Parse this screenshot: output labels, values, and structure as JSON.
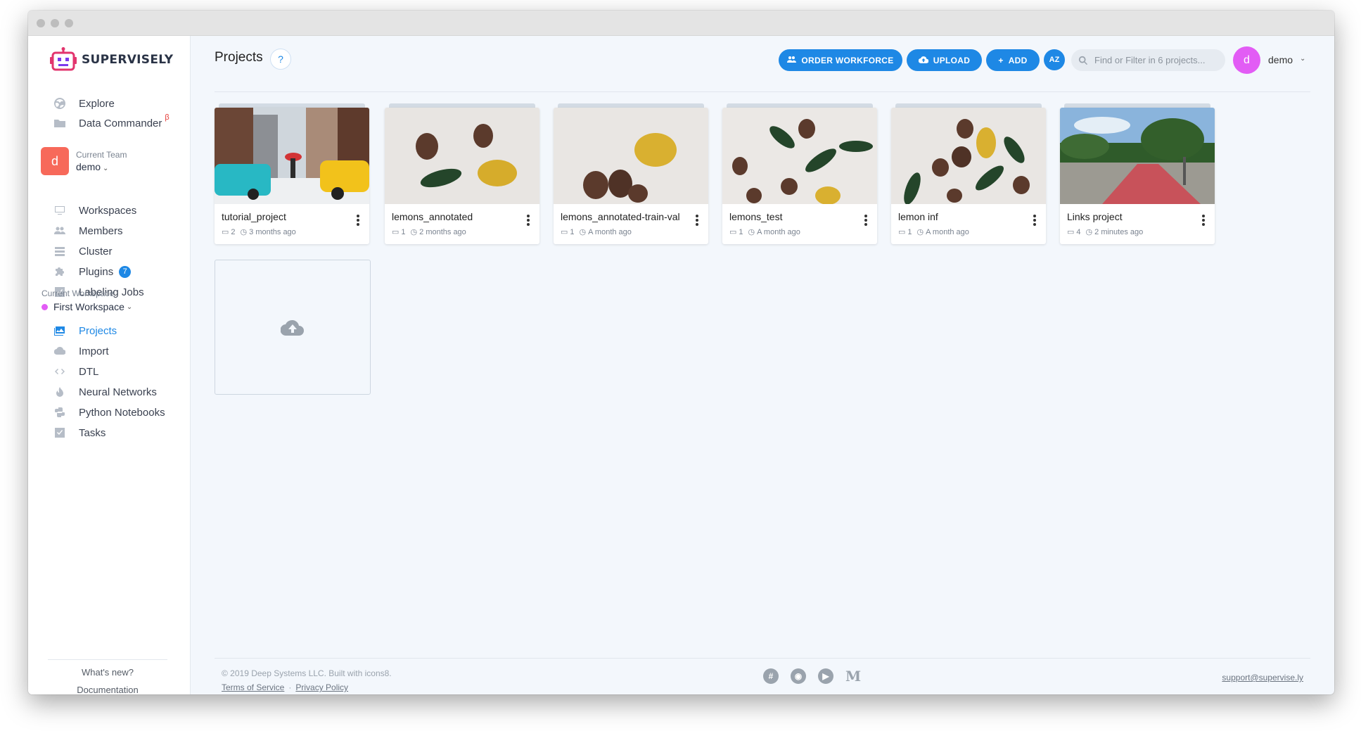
{
  "brand": {
    "name": "SUPERVISELY"
  },
  "sidebar": {
    "top_items": [
      {
        "label": "Explore",
        "icon": "globe-icon"
      },
      {
        "label": "Data Commander",
        "icon": "folder-icon",
        "beta": "β"
      }
    ],
    "team": {
      "label": "Current Team",
      "name": "demo",
      "avatar": "d"
    },
    "team_items": [
      {
        "label": "Workspaces",
        "icon": "monitor-icon"
      },
      {
        "label": "Members",
        "icon": "users-icon"
      },
      {
        "label": "Cluster",
        "icon": "server-icon"
      },
      {
        "label": "Plugins",
        "icon": "puzzle-icon",
        "badge": "7"
      },
      {
        "label": "Labeling Jobs",
        "icon": "checkbox-icon"
      }
    ],
    "workspace": {
      "label": "Current Workspace",
      "name": "First Workspace",
      "color": "#e25cf5"
    },
    "workspace_items": [
      {
        "label": "Projects",
        "icon": "images-icon",
        "active": true
      },
      {
        "label": "Import",
        "icon": "cloud-upload-icon"
      },
      {
        "label": "DTL",
        "icon": "code-icon"
      },
      {
        "label": "Neural Networks",
        "icon": "flame-icon"
      },
      {
        "label": "Python Notebooks",
        "icon": "python-icon"
      },
      {
        "label": "Tasks",
        "icon": "checkbox-icon"
      }
    ],
    "bottom_links": {
      "whats_new": "What's new?",
      "docs": "Documentation"
    }
  },
  "header": {
    "title": "Projects",
    "help": "?",
    "order_workforce": "ORDER WORKFORCE",
    "upload": "UPLOAD",
    "add": "ADD",
    "sort": "AZ",
    "search_placeholder": "Find or Filter in 6 projects...",
    "user_avatar": "d",
    "user_name": "demo"
  },
  "projects": [
    {
      "name": "tutorial_project",
      "count": "2",
      "time": "3 months ago"
    },
    {
      "name": "lemons_annotated",
      "count": "1",
      "time": "2 months ago"
    },
    {
      "name": "lemons_annotated-train-val",
      "count": "1",
      "time": "A month ago"
    },
    {
      "name": "lemons_test",
      "count": "1",
      "time": "A month ago"
    },
    {
      "name": "lemon inf",
      "count": "1",
      "time": "A month ago"
    },
    {
      "name": "Links project",
      "count": "4",
      "time": "2 minutes ago"
    }
  ],
  "footer": {
    "copyright": "© 2019 Deep Systems LLC. Built with icons8.",
    "terms": "Terms of Service",
    "privacy": "Privacy Policy",
    "support": "support@supervise.ly",
    "socials": [
      "slack-icon",
      "github-icon",
      "youtube-icon",
      "medium-icon"
    ]
  },
  "colors": {
    "accent": "#1e88e5",
    "team_avatar": "#f7695a",
    "user_avatar": "#e25cf5"
  }
}
